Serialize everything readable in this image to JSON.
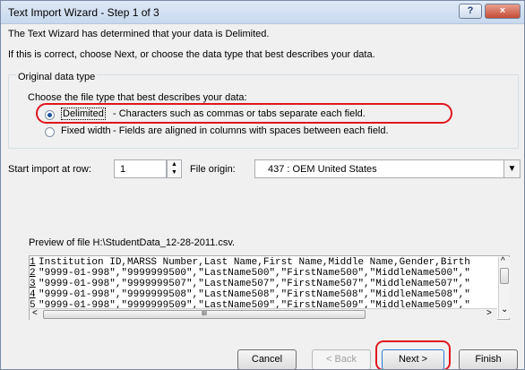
{
  "window": {
    "title": "Text Import Wizard - Step 1 of 3",
    "help_icon": "?",
    "close_icon": "×"
  },
  "intro": {
    "line1": "The Text Wizard has determined that your data is Delimited.",
    "line2": "If this is correct, choose Next, or choose the data type that best describes your data."
  },
  "original_data_type": {
    "group_title": "Original data type",
    "prompt": "Choose the file type that best describes your data:",
    "options": [
      {
        "label": "Delimited",
        "description": "- Characters such as commas or tabs separate each field.",
        "selected": true
      },
      {
        "label": "Fixed width",
        "description": "- Fields are aligned in columns with spaces between each field.",
        "selected": false
      }
    ]
  },
  "import": {
    "start_row_label": "Start import at row:",
    "start_row_value": "1",
    "file_origin_label": "File origin:",
    "file_origin_value": "437 : OEM United States"
  },
  "preview": {
    "label": "Preview of file H:\\StudentData_12-28-2011.csv.",
    "rows": [
      {
        "num": "1",
        "text": "Institution ID,MARSS Number,Last Name,First Name,Middle Name,Gender,Birth"
      },
      {
        "num": "2",
        "text": "\"9999-01-998\",\"9999999500\",\"LastName500\",\"FirstName500\",\"MiddleName500\",\""
      },
      {
        "num": "3",
        "text": "\"9999-01-998\",\"9999999507\",\"LastName507\",\"FirstName507\",\"MiddleName507\",\""
      },
      {
        "num": "4",
        "text": "\"9999-01-998\",\"9999999508\",\"LastName508\",\"FirstName508\",\"MiddleName508\",\""
      },
      {
        "num": "5",
        "text": "\"9999-01-998\",\"9999999509\",\"LastName509\",\"FirstName509\",\"MiddleName509\",\""
      }
    ],
    "scroll_grip": "III",
    "up": "^",
    "down": "⌄",
    "left": "<",
    "right": ">"
  },
  "buttons": {
    "cancel": "Cancel",
    "back": "< Back",
    "next": "Next >",
    "finish": "Finish"
  },
  "colors": {
    "highlight": "#e1161e",
    "selected_radio": "#1d4fa0"
  }
}
